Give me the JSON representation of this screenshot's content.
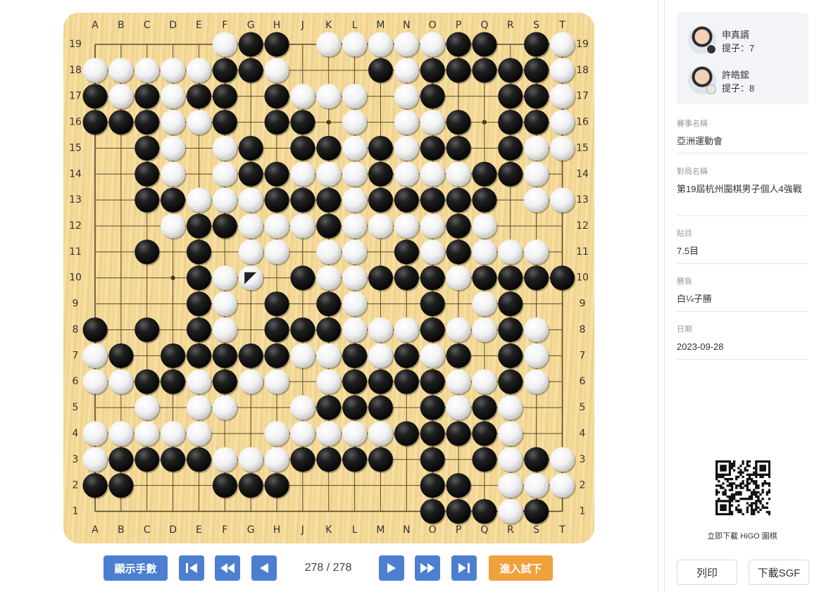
{
  "board": {
    "size": 19,
    "columns": [
      "A",
      "B",
      "C",
      "D",
      "E",
      "F",
      "G",
      "H",
      "J",
      "K",
      "L",
      "M",
      "N",
      "O",
      "P",
      "Q",
      "R",
      "S",
      "T"
    ],
    "rows": [
      "19",
      "18",
      "17",
      "16",
      "15",
      "14",
      "13",
      "12",
      "11",
      "10",
      "9",
      "8",
      "7",
      "6",
      "5",
      "4",
      "3",
      "2",
      "1"
    ],
    "star_points": [
      "D16",
      "K16",
      "Q16",
      "D10",
      "K10",
      "Q10",
      "D4",
      "K4",
      "Q4"
    ],
    "last_move": "G10",
    "position": [
      ".....WBB.WWWWWBB.BWWW",
      "WWWWWBBW...BWBBBBBWW",
      "BWBWBB.BWWW.WB..BBW",
      "BBBWWB.BB.W.WWB.BBWW",
      "..BW.WB.BBWBWBB.BWW",
      "..BW.WBBWWWBWWWBBW.",
      "..BBWWWBBBWBBBBB.WW.",
      "...WBBWWWBWWWWBW...W",
      "..B.B.WW.WW.BWBWWW.",
      "....BWW.BWWBBBWBBBBBW",
      "....BW.B.BW..B.WB..",
      "B.B.BW.BBBWWWBWWBW.",
      "WB.BBBBBWWBWBWB.BW.",
      "WWBBWBWW.WBBBBWWBW.",
      "..W.WW..WBBB.BWBW..",
      "WWWWW..WWWWWBBBBW..",
      "WBBBBWWWBBBB.B.BWBW",
      "BB...BBB.....BB.WWWW",
      ".............BBBWB."
    ]
  },
  "controls": {
    "show_moves_label": "顯示手數",
    "move_counter": "278 / 278",
    "enter_trial_label": "進入試下"
  },
  "players": [
    {
      "name": "申真諝",
      "captures": "提子：7",
      "color": "black"
    },
    {
      "name": "許皓鋐",
      "captures": "提子：8",
      "color": "white"
    }
  ],
  "info": [
    {
      "label": "賽事名稱",
      "value": "亞洲運動會"
    },
    {
      "label": "對局名稱",
      "value": "第19屆杭州圍棋男子個人4強戰"
    },
    {
      "label": "貼目",
      "value": "7.5目"
    },
    {
      "label": "勝負",
      "value": "白¼子勝"
    },
    {
      "label": "日期",
      "value": "2023-09-28"
    }
  ],
  "qr_caption": "立即下載 HiGO 圍棋",
  "buttons": {
    "print": "列印",
    "download_sgf": "下載SGF"
  },
  "colors": {
    "primary": "#4d7fd0",
    "accent": "#efa13a",
    "board": "#f3d797"
  }
}
